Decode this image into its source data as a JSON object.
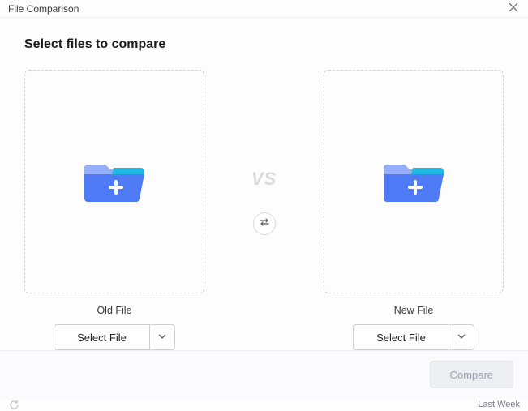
{
  "window": {
    "title": "File Comparison"
  },
  "heading": "Select files to compare",
  "middle": {
    "vs_label": "VS"
  },
  "slots": {
    "old": {
      "label": "Old File",
      "select_label": "Select File"
    },
    "new": {
      "label": "New File",
      "select_label": "Select File"
    }
  },
  "footer": {
    "compare_label": "Compare",
    "compare_enabled": false
  },
  "statusbar": {
    "right_text": "Last Week"
  },
  "icons": {
    "close": "close-icon",
    "folder_add": "folder-add-icon",
    "swap": "swap-icon",
    "chevron_down": "chevron-down-icon",
    "refresh": "refresh-icon"
  },
  "colors": {
    "border_dashed": "#cfd0d6",
    "accent_blue": "#4f7cf6",
    "accent_cyan": "#1fb9e3",
    "vs_gray": "#d8d8de",
    "disabled_bg": "#eceef2"
  }
}
